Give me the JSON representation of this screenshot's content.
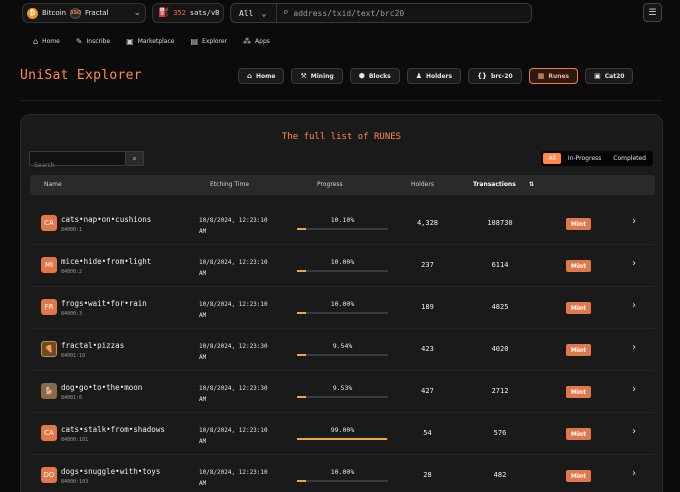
{
  "topbar": {
    "chain_primary": "Bitcoin",
    "chain_secondary": "Fractal",
    "fractal_badge": "3SO",
    "fee_value": "352",
    "fee_unit": "sats/vB",
    "search_scope": "All",
    "search_placeholder": "address/txid/text/brc20"
  },
  "nav": {
    "items": [
      {
        "label": "Home",
        "icon": "home-icon",
        "glyph": "⌂"
      },
      {
        "label": "Inscribe",
        "icon": "pen-icon",
        "glyph": "✎"
      },
      {
        "label": "Marketplace",
        "icon": "shop-icon",
        "glyph": "▣"
      },
      {
        "label": "Explorer",
        "icon": "doc-icon",
        "glyph": "▤"
      },
      {
        "label": "Apps",
        "icon": "grid-icon",
        "glyph": "⁂"
      }
    ]
  },
  "header": {
    "brand": "UniSat Explorer",
    "tabs": [
      {
        "label": "Home",
        "glyph": "⌂",
        "active": false
      },
      {
        "label": "Mining",
        "glyph": "⚒",
        "active": false
      },
      {
        "label": "Blocks",
        "glyph": "⬢",
        "active": false
      },
      {
        "label": "Holders",
        "glyph": "♟",
        "active": false
      },
      {
        "label": "brc-20",
        "glyph": "{}",
        "active": false
      },
      {
        "label": "Runes",
        "glyph": "▦",
        "active": true
      },
      {
        "label": "Cat20",
        "glyph": "▣",
        "active": false
      }
    ]
  },
  "panel": {
    "title": "The full list of RUNES",
    "search_placeholder": "Search",
    "filters": [
      {
        "label": "All",
        "active": true
      },
      {
        "label": "In-Progress",
        "active": false
      },
      {
        "label": "Completed",
        "active": false
      }
    ],
    "columns": {
      "name": "Name",
      "etching_time": "Etching Time",
      "progress": "Progress",
      "holders": "Holders",
      "transactions": "Transactions",
      "sort_icon": "⇅"
    },
    "rows": [
      {
        "avatar": "CA",
        "avatar_style": "",
        "name": "cats•nap•on•cushions",
        "id": "84000:1",
        "etch_line1": "10/8/2024, 12:23:10",
        "etch_line2": "AM",
        "progress_label": "10.10%",
        "progress": 0.101,
        "holders": "4,328",
        "transactions": "108730",
        "action": "Mint"
      },
      {
        "avatar": "MI",
        "avatar_style": "",
        "name": "mice•hide•from•light",
        "id": "84000:2",
        "etch_line1": "10/8/2024, 12:23:10",
        "etch_line2": "AM",
        "progress_label": "10.00%",
        "progress": 0.1,
        "holders": "237",
        "transactions": "6114",
        "action": "Mint"
      },
      {
        "avatar": "FR",
        "avatar_style": "",
        "name": "frogs•wait•for•rain",
        "id": "84000:3",
        "etch_line1": "10/8/2024, 12:23:10",
        "etch_line2": "AM",
        "progress_label": "10.00%",
        "progress": 0.1,
        "holders": "189",
        "transactions": "4825",
        "action": "Mint"
      },
      {
        "avatar": "🍕",
        "avatar_style": "pizza",
        "name": "fractal•pizzas",
        "id": "84001:10",
        "etch_line1": "10/8/2024, 12:23:30",
        "etch_line2": "AM",
        "progress_label": "9.54%",
        "progress": 0.0954,
        "holders": "423",
        "transactions": "4020",
        "action": "Mint"
      },
      {
        "avatar": "🐕",
        "avatar_style": "dog",
        "name": "dog•go•to•the•moon",
        "id": "84001:6",
        "etch_line1": "10/8/2024, 12:23:30",
        "etch_line2": "AM",
        "progress_label": "9.53%",
        "progress": 0.0953,
        "holders": "427",
        "transactions": "2712",
        "action": "Mint"
      },
      {
        "avatar": "CA",
        "avatar_style": "",
        "name": "cats•stalk•from•shadows",
        "id": "84000:101",
        "etch_line1": "10/8/2024, 12:23:10",
        "etch_line2": "AM",
        "progress_label": "99.00%",
        "progress": 0.99,
        "holders": "54",
        "transactions": "576",
        "action": "Mint"
      },
      {
        "avatar": "DO",
        "avatar_style": "",
        "name": "dogs•snuggle•with•toys",
        "id": "84000:103",
        "etch_line1": "10/8/2024, 12:23:10",
        "etch_line2": "AM",
        "progress_label": "10.00%",
        "progress": 0.1,
        "holders": "28",
        "transactions": "482",
        "action": "Mint"
      }
    ]
  },
  "colors": {
    "accent": "#ff8a4a",
    "progress_fill": "#f2a93b",
    "mint_badge": "#e0784a",
    "background": "#0b0b0b",
    "panel": "#1a1a1a"
  }
}
